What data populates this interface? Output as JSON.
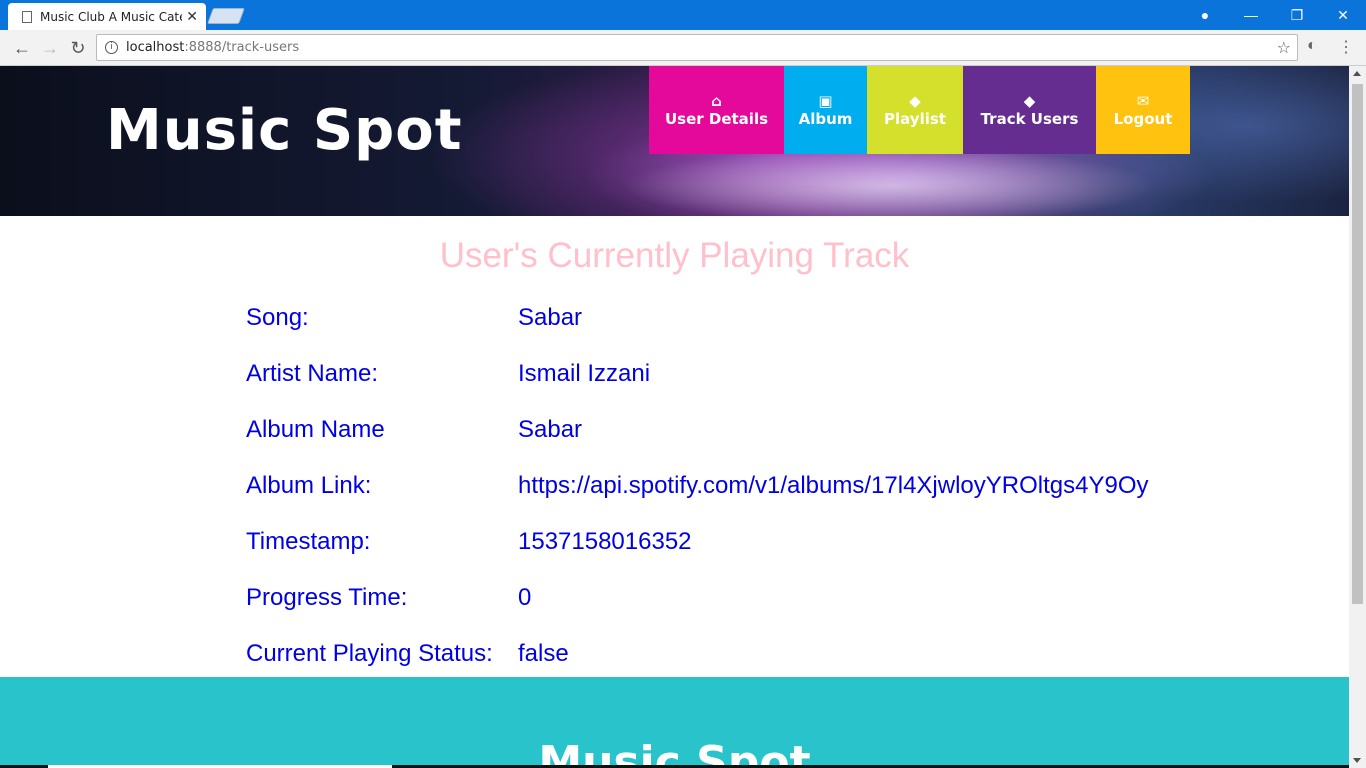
{
  "browser": {
    "tab_title": "Music Club A Music Cate",
    "url_host": "localhost",
    "url_rest": ":8888/track-users"
  },
  "site": {
    "brand": "Music Spot",
    "nav": [
      {
        "label": "User Details",
        "icon": "home-icon",
        "color": "#e5099b"
      },
      {
        "label": "Album",
        "icon": "image-icon",
        "color": "#00aeef"
      },
      {
        "label": "Playlist",
        "icon": "tags-icon",
        "color": "#d4e02c"
      },
      {
        "label": "Track Users",
        "icon": "tags-icon",
        "color": "#662d91"
      },
      {
        "label": "Logout",
        "icon": "envelope-icon",
        "color": "#ffc20e"
      }
    ]
  },
  "main": {
    "heading": "User's Currently Playing Track",
    "rows": [
      {
        "label": "Song:",
        "value": "Sabar"
      },
      {
        "label": "Artist Name:",
        "value": "Ismail Izzani"
      },
      {
        "label": "Album Name",
        "value": "Sabar"
      },
      {
        "label": "Album Link:",
        "value": "https://api.spotify.com/v1/albums/17l4XjwloyYROltgs4Y9Oy"
      },
      {
        "label": "Timestamp:",
        "value": "1537158016352"
      },
      {
        "label": "Progress Time:",
        "value": "0"
      },
      {
        "label": "Current Playing Status:",
        "value": "false"
      }
    ]
  },
  "footer": {
    "brand": "Music Spot",
    "color": "#29c4cb"
  }
}
